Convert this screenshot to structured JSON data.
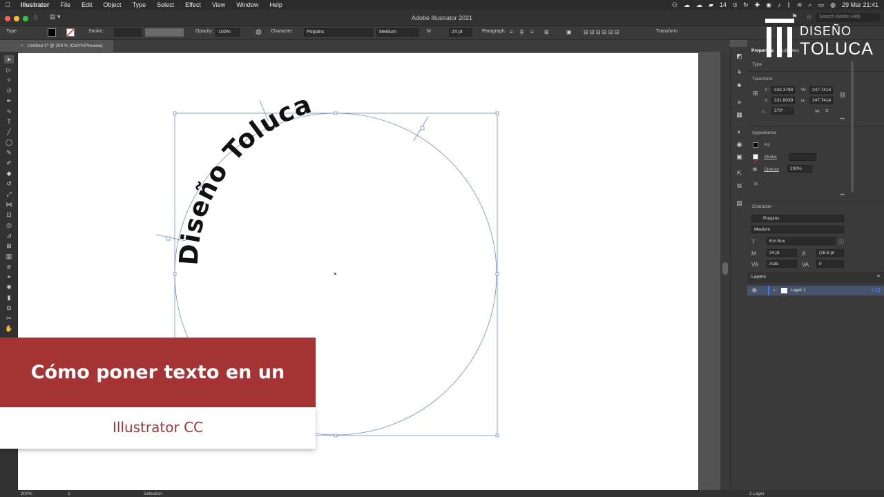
{
  "menubar": {
    "app_name": "Illustrator",
    "items": [
      "File",
      "Edit",
      "Object",
      "Type",
      "Select",
      "Effect",
      "View",
      "Window",
      "Help"
    ],
    "battery": "14",
    "datetime": "29 Mar  21:41"
  },
  "window": {
    "title": "Adobe Illustrator 2021",
    "search_placeholder": "Search Adobe Help"
  },
  "control_bar": {
    "selection_type": "Type",
    "stroke_label": "Stroke:",
    "opacity_label": "Opacity:",
    "opacity_value": "100%",
    "character_label": "Character:",
    "font_family": "Poppins",
    "font_style": "Medium",
    "font_size": "24 pt",
    "paragraph_label": "Paragraph:",
    "transform_label": "Transform"
  },
  "document_tab": {
    "close_glyph": "×",
    "label": "Untitled-1* @ 200 % (CMYK/Preview)"
  },
  "artwork": {
    "path_text": "Diseño Toluca",
    "text_color": "#111111",
    "path_color": "#6a8fc8"
  },
  "properties_panel": {
    "tab_properties": "Properties",
    "tab_libraries": "Libraries",
    "selection_kind": "Type",
    "transform_title": "Transform",
    "x_label": "X:",
    "x_value": "333.3798",
    "y_label": "Y:",
    "y_value": "331.8039",
    "w_label": "W:",
    "w_value": "247.7414",
    "h_label": "H:",
    "h_value": "247.7414",
    "rotation_value": "270°",
    "appearance_title": "Appearance",
    "fill_label": "Fill",
    "stroke_label": "Stroke",
    "opacity_label": "Opacity",
    "opacity_value": "100%",
    "fx_label": "fx.",
    "character_title": "Character",
    "font_family": "Poppins",
    "font_style": "Medium",
    "em_box": "Em Box",
    "font_size": "24 pt",
    "leading": "(28.8 pt",
    "kerning": "Auto",
    "tracking": "0"
  },
  "layers_panel": {
    "title": "Layers",
    "layer_name": "Layer 1",
    "count_label": "1 Layer"
  },
  "status_bar": {
    "zoom": "200%",
    "page": "1",
    "tool": "Selection"
  },
  "logo": {
    "line1": "DISEÑO",
    "line2": "TOLUCA"
  },
  "overlay": {
    "title": "Cómo poner texto en un círculo",
    "subtitle": "Illustrator CC",
    "banner_color": "#a63434"
  }
}
